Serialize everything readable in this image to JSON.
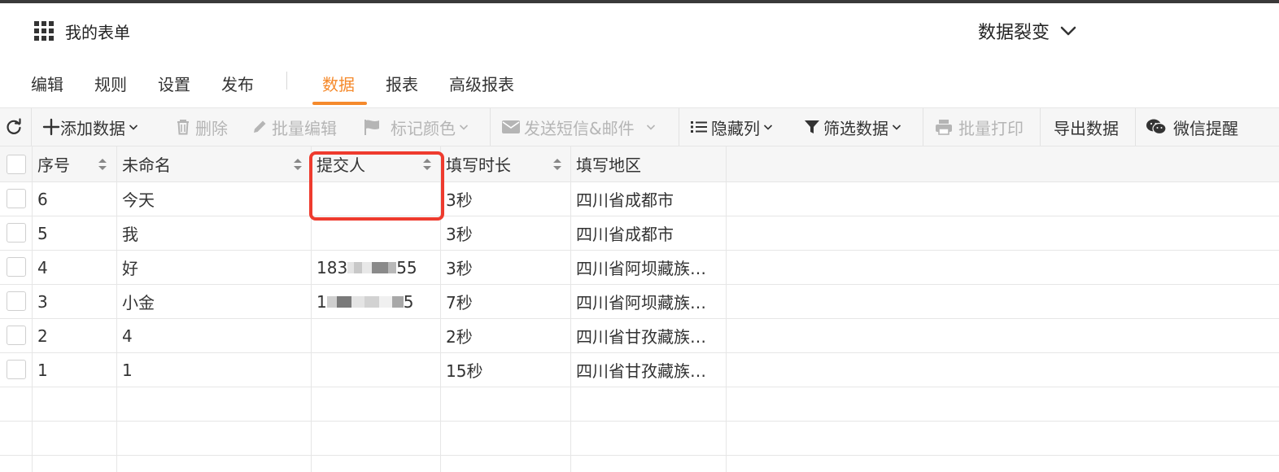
{
  "header": {
    "form_title": "我的表单",
    "project_name": "数据裂变"
  },
  "tabs": [
    {
      "label": "编辑"
    },
    {
      "label": "规则"
    },
    {
      "label": "设置"
    },
    {
      "label": "发布"
    },
    {
      "label": "数据",
      "active": true
    },
    {
      "label": "报表"
    },
    {
      "label": "高级报表"
    }
  ],
  "toolbar": {
    "add_data": "添加数据",
    "delete": "删除",
    "batch_edit": "批量编辑",
    "mark_color": "标记颜色",
    "send_sms_email": "发送短信&邮件",
    "hide_columns": "隐藏列",
    "filter_data": "筛选数据",
    "batch_print": "批量打印",
    "export_data": "导出数据",
    "wechat_remind": "微信提醒"
  },
  "table": {
    "columns": [
      "序号",
      "未命名",
      "提交人",
      "填写时长",
      "填写地区"
    ],
    "rows": [
      {
        "seq": "6",
        "name": "今天",
        "submitter": "",
        "duration": "3秒",
        "region": "四川省成都市"
      },
      {
        "seq": "5",
        "name": "我",
        "submitter": "",
        "duration": "3秒",
        "region": "四川省成都市"
      },
      {
        "seq": "4",
        "name": "好",
        "submitter_prefix": "183",
        "submitter_suffix": "55",
        "duration": "3秒",
        "region": "四川省阿坝藏族…"
      },
      {
        "seq": "3",
        "name": "小金",
        "submitter_prefix": "1",
        "submitter_suffix": "5",
        "duration": "7秒",
        "region": "四川省阿坝藏族…"
      },
      {
        "seq": "2",
        "name": "4",
        "submitter": "",
        "duration": "2秒",
        "region": "四川省甘孜藏族…"
      },
      {
        "seq": "1",
        "name": "1",
        "submitter": "",
        "duration": "15秒",
        "region": "四川省甘孜藏族…"
      }
    ]
  },
  "colors": {
    "accent": "#f58a2c",
    "highlight": "#ee3b2e"
  }
}
